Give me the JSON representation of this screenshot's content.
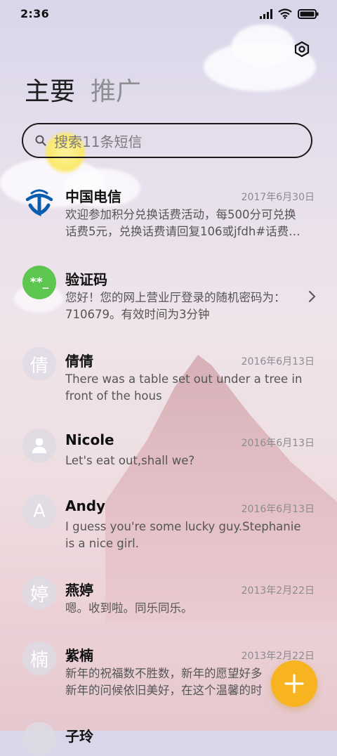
{
  "status": {
    "time": "2:36"
  },
  "tabs": [
    {
      "label": "主要",
      "active": true
    },
    {
      "label": "推广",
      "active": false
    }
  ],
  "search": {
    "placeholder": "搜索11条短信"
  },
  "conversations": [
    {
      "name": "中国电信",
      "date": "2017年6月30日",
      "line1": "欢迎参加积分兑换话费活动，每500分可兑换",
      "line2": "话费5元，兑换话费请回复106或jfdh#话费…",
      "avatar": "china-telecom-logo"
    },
    {
      "name": "验证码",
      "date": "",
      "line1": "您好！您的网上营业厅登录的随机密码为：",
      "line2": "710679。有效时间为3分钟",
      "avatar_text": "**_",
      "avatar_color": "#5cc64f"
    },
    {
      "name": "倩倩",
      "date": "2016年6月13日",
      "line1": "There was a table set out under a tree in",
      "line2": "front of the hous",
      "avatar_text": "倩"
    },
    {
      "name": "Nicole",
      "date": "2016年6月13日",
      "line1": "Let's eat out,shall we?",
      "line2": "",
      "avatar": "person-icon"
    },
    {
      "name": "Andy",
      "date": "2016年6月13日",
      "line1": "I guess you're some lucky guy.Stephanie",
      "line2": "is a nice girl.",
      "avatar_text": "A"
    },
    {
      "name": "燕婷",
      "date": "2013年2月22日",
      "line1": "嗯。收到啦。同乐同乐。",
      "line2": "",
      "avatar_text": "婷"
    },
    {
      "name": "紫楠",
      "date": "2013年2月22日",
      "line1": "新年的祝福数不胜数，新年的愿望好多",
      "line2": "新年的问候依旧美好，在这个温馨的时",
      "avatar_text": "楠"
    },
    {
      "name": "子玲",
      "date": "",
      "line1": "",
      "line2": "",
      "avatar_text": ""
    }
  ],
  "colors": {
    "fab": "#f7b320",
    "accent_green": "#5cc64f",
    "telecom_blue": "#0b5cad"
  }
}
